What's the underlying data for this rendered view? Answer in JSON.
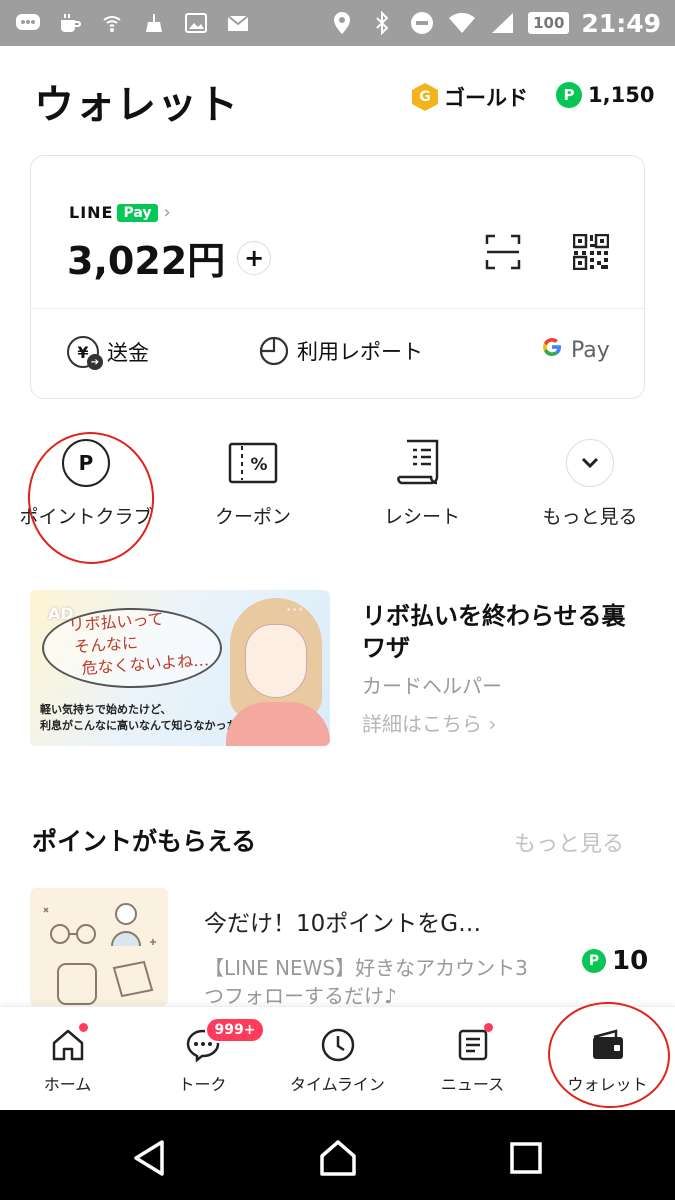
{
  "status_bar": {
    "battery": "100",
    "time": "21:49"
  },
  "header": {
    "title": "ウォレット",
    "gold_badge": "G",
    "gold_label": "ゴールド",
    "points_badge": "P",
    "points_value": "1,150"
  },
  "pay_card": {
    "brand_line": "LINE",
    "brand_pay": "Pay",
    "chevron": "›",
    "balance": "3,022円",
    "topup_symbol": "+",
    "actions": {
      "send": "送金",
      "report": "利用レポート",
      "gpay_g": "G",
      "gpay_pay": "Pay"
    },
    "yen_symbol": "¥"
  },
  "quick_menu": [
    {
      "label": "ポイントクラブ",
      "icon": "point-club-icon",
      "icon_text": "P"
    },
    {
      "label": "クーポン",
      "icon": "coupon-icon",
      "icon_text": "%"
    },
    {
      "label": "レシート",
      "icon": "receipt-icon"
    },
    {
      "label": "もっと見る",
      "icon": "chevron-down-icon"
    }
  ],
  "ad": {
    "tag": "AD",
    "more": "···",
    "handwriting_line1": "リボ払いって",
    "handwriting_line2": "そんなに",
    "handwriting_line3": "危なくないよね…",
    "caption_line1": "軽い気持ちで始めたけど、",
    "caption_line2": "利息がこんなに高いなんて知らなかった…",
    "title": "リボ払いを終わらせる裏ワザ",
    "advertiser": "カードヘルパー",
    "link": "詳細はこちら ›"
  },
  "points_section": {
    "title": "ポイントがもらえる",
    "more": "もっと見る",
    "offer": {
      "title": "今だけ！10ポイントをG…",
      "description": "【LINE NEWS】好きなアカウント3つフォローするだけ♪",
      "points_badge": "P",
      "points": "10"
    }
  },
  "bottom_nav": {
    "items": [
      {
        "label": "ホーム",
        "icon": "home-icon"
      },
      {
        "label": "トーク",
        "icon": "chat-icon",
        "badge": "999+"
      },
      {
        "label": "タイムライン",
        "icon": "clock-icon"
      },
      {
        "label": "ニュース",
        "icon": "news-icon"
      },
      {
        "label": "ウォレット",
        "icon": "wallet-icon"
      }
    ]
  },
  "colors": {
    "line_green": "#06c755",
    "gold": "#f2b31b",
    "badge_red": "#ff3b5c",
    "annotation_red": "#e0241b"
  }
}
